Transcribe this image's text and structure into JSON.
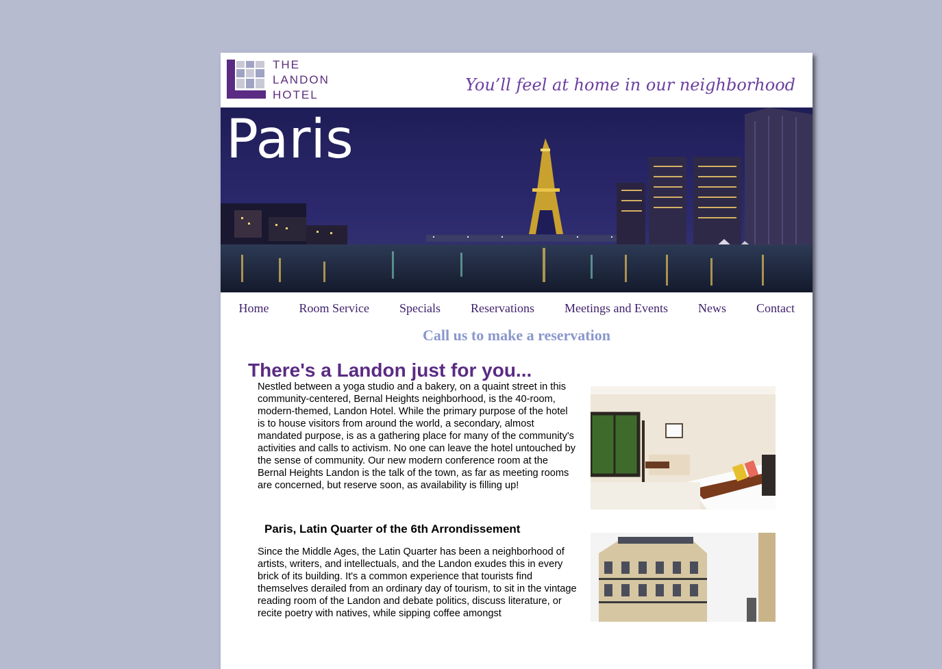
{
  "header": {
    "logo_lines": [
      "THE",
      "LANDON",
      "HOTEL"
    ],
    "tagline": "You’ll feel at home in our neighborhood"
  },
  "hero": {
    "title": "Paris"
  },
  "nav": {
    "items": [
      "Home",
      "Room Service",
      "Specials",
      "Reservations",
      "Meetings and Events",
      "News",
      "Contact"
    ]
  },
  "callout": "Call us to make a reservation",
  "main": {
    "heading": "There's a Landon just for you...",
    "intro": "Nestled between a yoga studio and a bakery, on a quaint street in this community-centered, Bernal Heights neighborhood, is the 40-room, modern-themed, Landon Hotel. While the primary purpose of the hotel is to house visitors from around the world, a secondary, almost mandated purpose, is as a gathering place for many of the community's activities and calls to activism. No one can leave the hotel untouched by the sense of community. Our new modern conference room at the Bernal Heights Landon is the talk of the town, as far as meeting rooms are concerned, but reserve soon, as availability is filling up!",
    "subheading": "Paris, Latin Quarter of the 6th Arrondissement",
    "latin_quarter": "Since the Middle Ages, the Latin Quarter has been a neighborhood of artists, writers, and intellectuals, and the Landon exudes this in every brick of its building. It's a common experience that tourists find themselves derailed from an ordinary day of tourism, to sit in the vintage reading room of the Landon and debate politics, discuss literature, or recite poetry with natives, while sipping coffee amongst"
  },
  "colors": {
    "background": "#b7bbd0",
    "brand_purple": "#5a2b83",
    "callout": "#8a97cc"
  }
}
